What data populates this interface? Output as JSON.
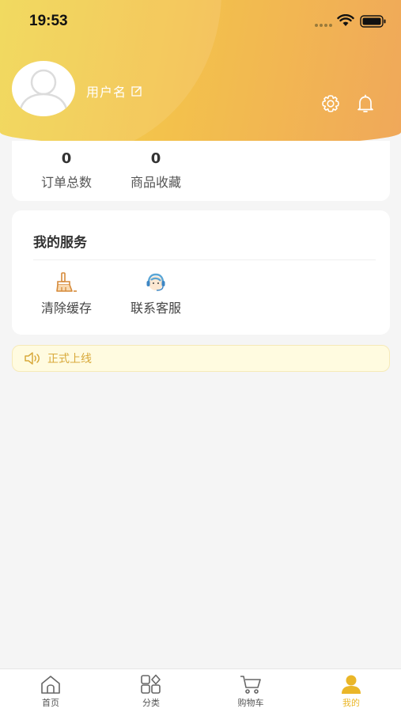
{
  "status_bar": {
    "time": "19:53"
  },
  "header": {
    "username": "用户名"
  },
  "stats": [
    {
      "value": "0",
      "label": "订单总数"
    },
    {
      "value": "0",
      "label": "商品收藏"
    }
  ],
  "services": {
    "title": "我的服务",
    "items": [
      {
        "label": "清除缓存",
        "icon": "brush-icon"
      },
      {
        "label": "联系客服",
        "icon": "customer-service-icon"
      }
    ]
  },
  "notice": {
    "text": "正式上线"
  },
  "tabbar": {
    "items": [
      {
        "label": "首页",
        "icon": "home-icon"
      },
      {
        "label": "分类",
        "icon": "category-icon"
      },
      {
        "label": "购物车",
        "icon": "cart-icon"
      },
      {
        "label": "我的",
        "icon": "user-icon"
      }
    ],
    "active": "我的"
  },
  "colors": {
    "accent": "#eab628",
    "header_start": "#f0d64e",
    "header_end": "#f0a85a",
    "notice_bg": "#fffbe0"
  }
}
